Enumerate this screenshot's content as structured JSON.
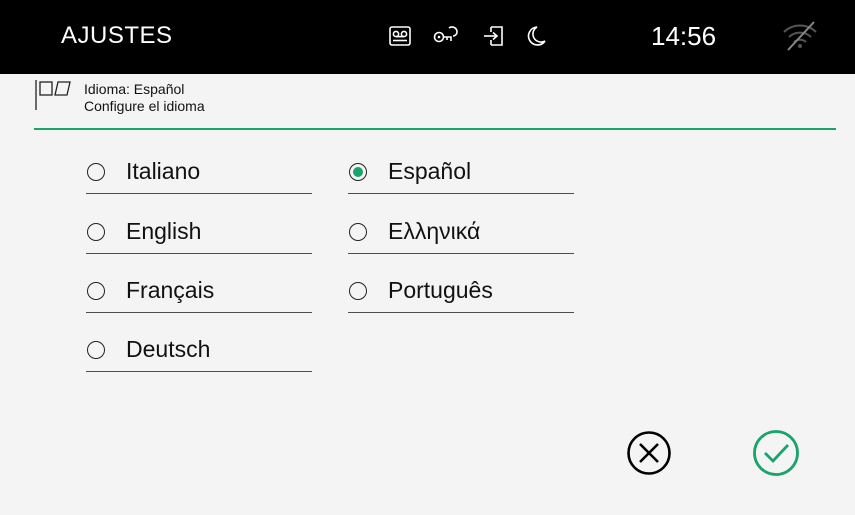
{
  "topbar": {
    "title": "AJUSTES",
    "time": "14:56",
    "status_icons": [
      "voicemail-icon",
      "key-icon",
      "door-entry-icon",
      "moon-icon"
    ],
    "wifi_icon": "wifi-off-icon"
  },
  "header": {
    "icon": "flags-icon",
    "line1": "Idioma: Español",
    "line2": "Configure el idioma"
  },
  "languages": {
    "col1": [
      {
        "label": "Italiano",
        "selected": false
      },
      {
        "label": "English",
        "selected": false
      },
      {
        "label": "Français",
        "selected": false
      },
      {
        "label": "Deutsch",
        "selected": false
      }
    ],
    "col2": [
      {
        "label": "Español",
        "selected": true
      },
      {
        "label": "Ελληνικά",
        "selected": false
      },
      {
        "label": "Português",
        "selected": false
      }
    ]
  },
  "actions": {
    "cancel_icon": "cancel-icon",
    "confirm_icon": "confirm-icon"
  },
  "colors": {
    "accent": "#1aa36b",
    "topbar": "#000000",
    "background": "#f4f4f4"
  }
}
